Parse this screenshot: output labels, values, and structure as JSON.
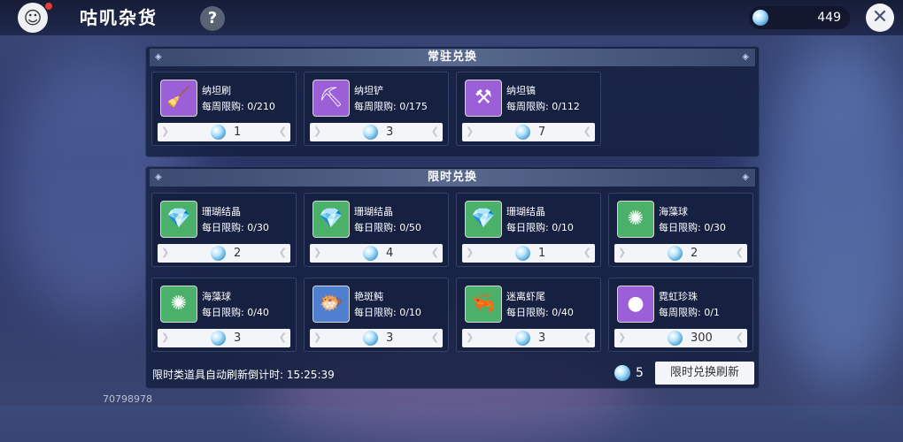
{
  "shop": {
    "title": "咕叽杂货",
    "help_icon": "?",
    "currency_amount": "449",
    "close_icon": "✕",
    "avatar_icon": "☺"
  },
  "permanent": {
    "header": "常驻兑换",
    "items": [
      {
        "name": "纳坦刷",
        "limit": "每周限购: 0/210",
        "price": "1",
        "icon": "🧹",
        "bg": "#9b5fd8"
      },
      {
        "name": "纳坦铲",
        "limit": "每周限购: 0/175",
        "price": "3",
        "icon": "⛏",
        "bg": "#9b5fd8"
      },
      {
        "name": "纳坦镐",
        "limit": "每周限购: 0/112",
        "price": "7",
        "icon": "⚒",
        "bg": "#9b5fd8"
      }
    ]
  },
  "limited": {
    "header": "限时兑换",
    "items": [
      {
        "name": "珊瑚结晶",
        "limit": "每日限购: 0/30",
        "price": "2",
        "icon": "💎",
        "bg": "#4bb06a"
      },
      {
        "name": "珊瑚结晶",
        "limit": "每日限购: 0/50",
        "price": "4",
        "icon": "💎",
        "bg": "#4bb06a"
      },
      {
        "name": "珊瑚结晶",
        "limit": "每日限购: 0/10",
        "price": "1",
        "icon": "💎",
        "bg": "#4bb06a"
      },
      {
        "name": "海藻球",
        "limit": "每日限购: 0/30",
        "price": "2",
        "icon": "✺",
        "bg": "#4bb06a"
      },
      {
        "name": "海藻球",
        "limit": "每日限购: 0/40",
        "price": "3",
        "icon": "✺",
        "bg": "#4bb06a"
      },
      {
        "name": "艳斑鲀",
        "limit": "每日限购: 0/10",
        "price": "3",
        "icon": "🐡",
        "bg": "#4e7fd0"
      },
      {
        "name": "迷离虾尾",
        "limit": "每日限购: 0/40",
        "price": "3",
        "icon": "🦐",
        "bg": "#4bb06a"
      },
      {
        "name": "霓虹珍珠",
        "limit": "每周限购: 0/1",
        "price": "300",
        "icon": "●",
        "bg": "#9b5fd8"
      }
    ],
    "countdown_text": "限时类道具自动刷新倒计时: 15:25:39",
    "refresh_cost": "5",
    "refresh_button": "限时兑换刷新"
  },
  "uid": "70798978"
}
